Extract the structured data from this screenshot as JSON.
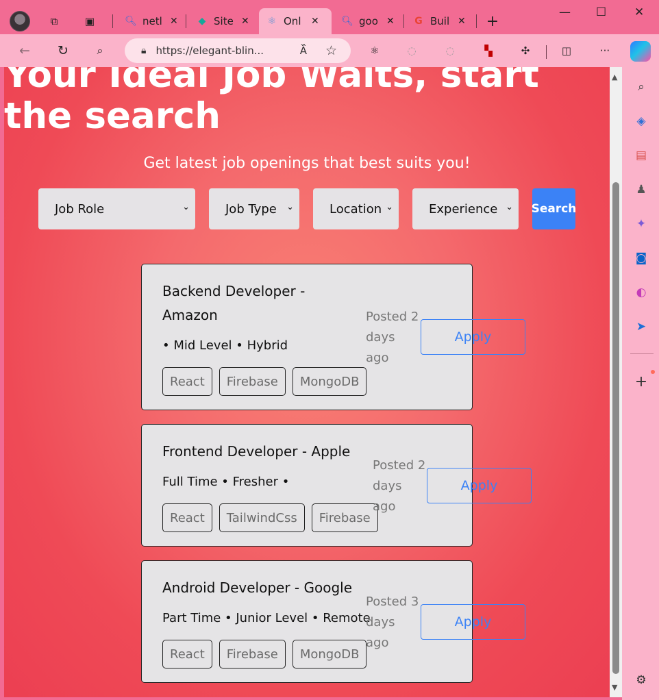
{
  "browser": {
    "tabs": [
      {
        "title": "netl",
        "icon": "search-icon"
      },
      {
        "title": "Site",
        "icon": "diamond-icon"
      },
      {
        "title": "Onl",
        "icon": "atom-icon",
        "active": true
      },
      {
        "title": "goo",
        "icon": "search-icon"
      },
      {
        "title": "Buil",
        "icon": "google-icon"
      }
    ],
    "url": "https://elegant-blin...",
    "colors": {
      "frame": "#f26b93",
      "toolbar": "#fbb3ca"
    }
  },
  "hero": {
    "title": "Your Ideal Job Waits, start the search",
    "subtitle": "Get latest job openings that best suits you!"
  },
  "filters": {
    "job_role": "Job Role",
    "job_type": "Job Type",
    "location": "Location",
    "experience": "Experience",
    "search_label": "Search"
  },
  "jobs": [
    {
      "role": "Backend Developer - Amazon",
      "meta": "• Mid Level • Hybrid",
      "tags": [
        "React",
        "Firebase",
        "MongoDB"
      ],
      "posted": "Posted 2 days ago",
      "apply_label": "Apply"
    },
    {
      "role": "Frontend Developer - Apple",
      "meta": "Full Time • Fresher •",
      "tags": [
        "React",
        "TailwindCss",
        "Firebase"
      ],
      "posted": "Posted 2 days ago",
      "apply_label": "Apply"
    },
    {
      "role": "Android Developer - Google",
      "meta": "Part Time • Junior Level • Remote",
      "tags": [
        "React",
        "Firebase",
        "MongoDB"
      ],
      "posted": "Posted 3 days ago",
      "apply_label": "Apply"
    }
  ],
  "theme": {
    "accent": "#3b82f6",
    "card_bg": "#e5e4e6"
  }
}
